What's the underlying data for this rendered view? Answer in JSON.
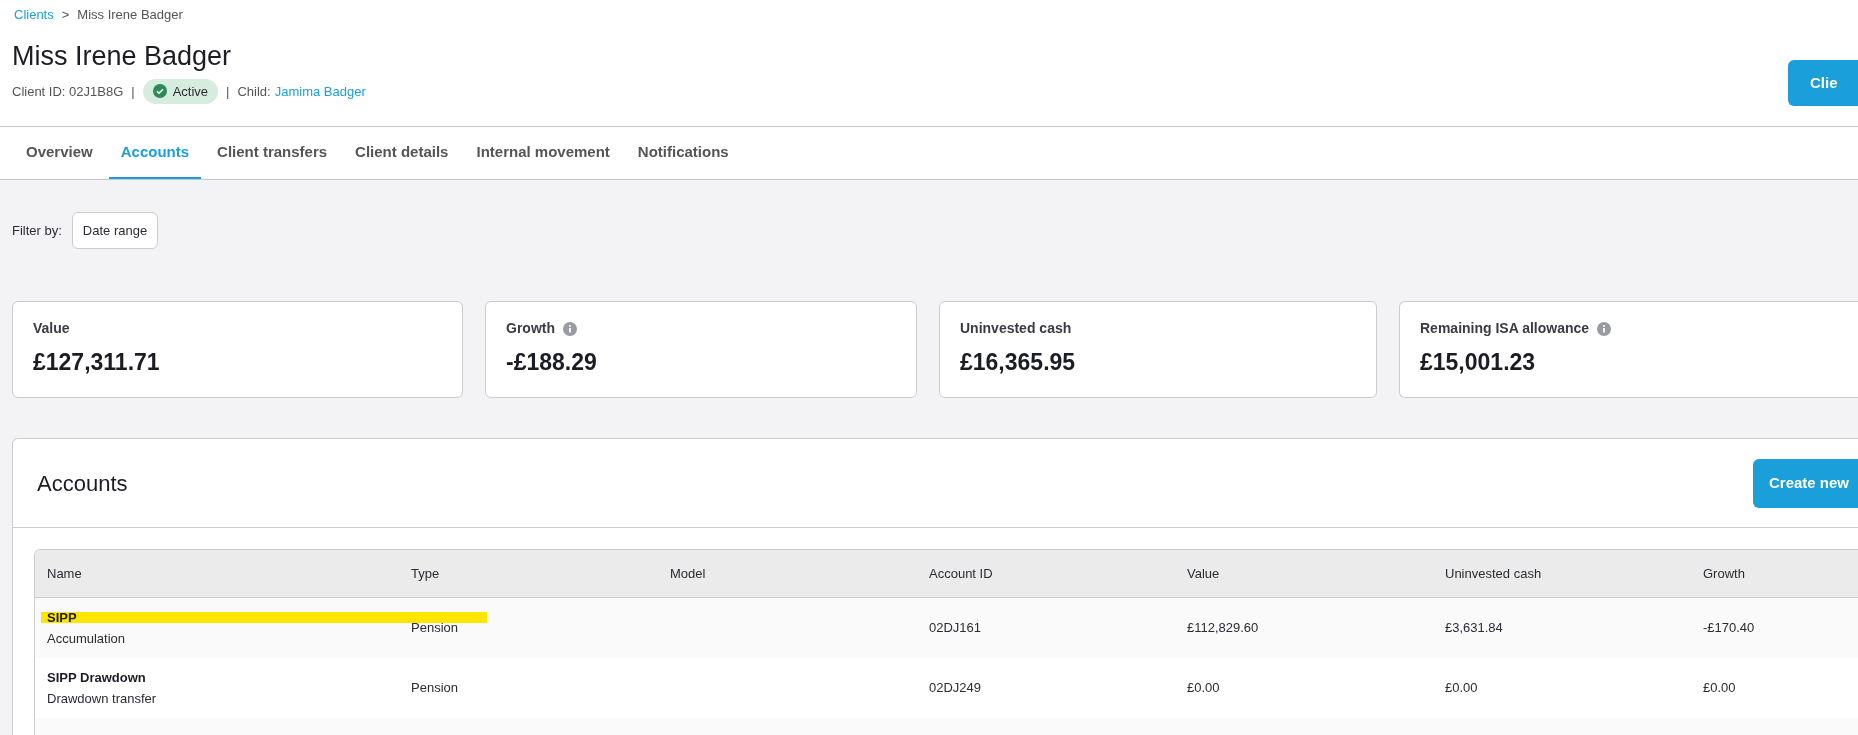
{
  "breadcrumb": [
    {
      "label": "Clients",
      "kind": "link"
    },
    {
      "label": ">",
      "kind": "separator"
    },
    {
      "label": "Miss Irene Badger",
      "kind": "current"
    }
  ],
  "title": "Miss Irene Badger",
  "meta": {
    "client_id": "Client ID: 02J1B8G",
    "separator_1": "|",
    "status": "Active",
    "separator_2": "|",
    "child_label": "Child:",
    "child_link": "Jamima Badger"
  },
  "header_button": "Clie",
  "tabs": [
    {
      "label": "Overview",
      "selected": false
    },
    {
      "label": "Accounts",
      "selected": true
    },
    {
      "label": "Client transfers",
      "selected": false
    },
    {
      "label": "Client details",
      "selected": false
    },
    {
      "label": "Internal movement",
      "selected": false
    },
    {
      "label": "Notifications",
      "selected": false
    }
  ],
  "filter": {
    "label": "Filter by:",
    "button": "Date range"
  },
  "summary_cards": [
    {
      "label": "Value",
      "value": "£127,311.71",
      "info": false
    },
    {
      "label": "Growth",
      "value": "-£188.29",
      "info": true
    },
    {
      "label": "Uninvested cash",
      "value": "£16,365.95",
      "info": false
    },
    {
      "label": "Remaining ISA allowance",
      "value": "£15,001.23",
      "info": true
    }
  ],
  "accounts": {
    "title": "Accounts",
    "create_button": "Create new",
    "columns": [
      "Name",
      "Type",
      "Model",
      "Account ID",
      "Value",
      "Uninvested cash",
      "Growth"
    ],
    "rows": [
      {
        "name": "SIPP",
        "subtitle": "Accumulation",
        "type": "Pension",
        "model": "",
        "account_id": "02DJ161",
        "value": "£112,829.60",
        "uninvested_cash": "£3,631.84",
        "growth": "-£170.40",
        "highlighted": true
      },
      {
        "name": "SIPP Drawdown",
        "subtitle": "Drawdown transfer",
        "type": "Pension",
        "model": "",
        "account_id": "02DJ249",
        "value": "£0.00",
        "uninvested_cash": "£0.00",
        "growth": "£0.00",
        "highlighted": false
      }
    ]
  }
}
